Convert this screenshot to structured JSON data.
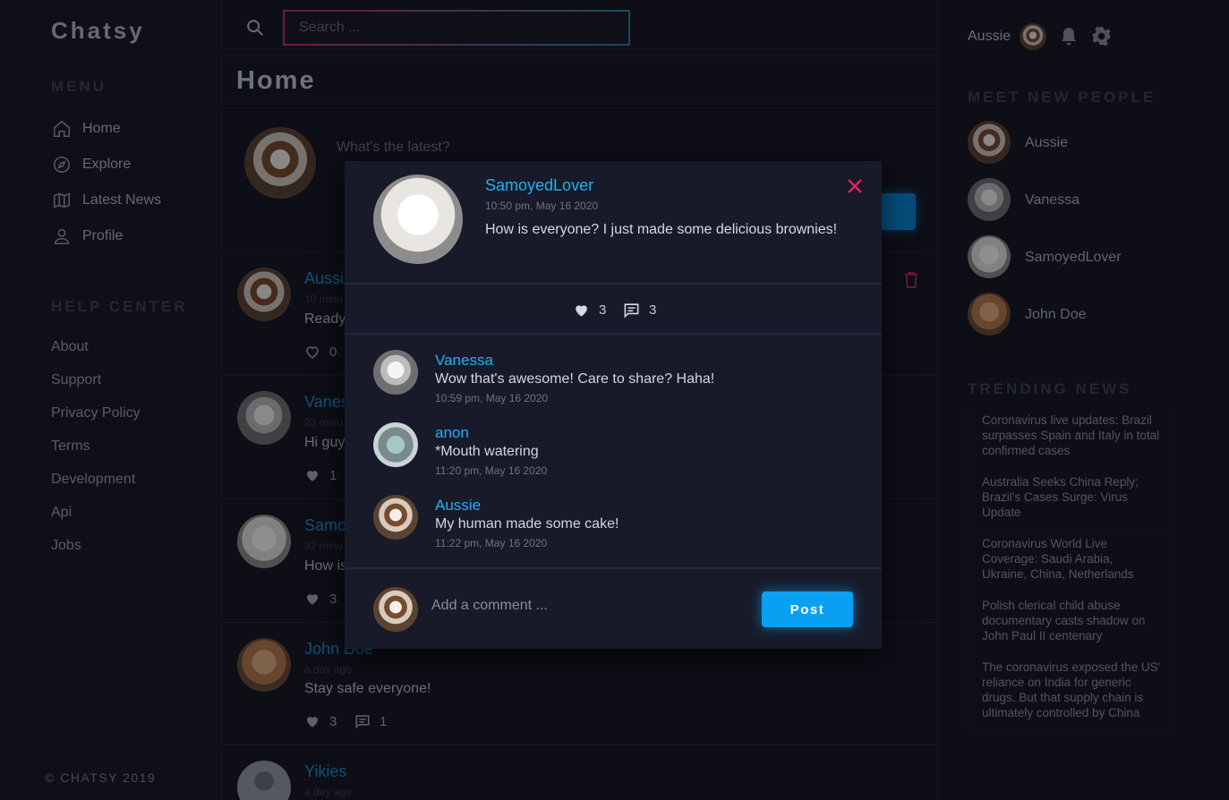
{
  "app": {
    "brand": "Chatsy",
    "copyright": "© CHATSY 2019"
  },
  "menu": {
    "heading": "MENU",
    "items": [
      {
        "label": "Home",
        "icon": "home-icon"
      },
      {
        "label": "Explore",
        "icon": "compass-icon"
      },
      {
        "label": "Latest News",
        "icon": "map-icon"
      },
      {
        "label": "Profile",
        "icon": "user-icon"
      }
    ]
  },
  "help": {
    "heading": "HELP CENTER",
    "items": [
      "About",
      "Support",
      "Privacy Policy",
      "Terms",
      "Development",
      "Api",
      "Jobs"
    ]
  },
  "search": {
    "placeholder": "Search ..."
  },
  "page": {
    "title": "Home"
  },
  "composer": {
    "placeholder": "What's the latest?"
  },
  "feed": [
    {
      "name": "Aussi",
      "time": "10 minu",
      "text": "Ready",
      "likes": "0"
    },
    {
      "name": "Vanes",
      "time": "23 minu",
      "text": "Hi guy",
      "likes": "1"
    },
    {
      "name": "Samo",
      "time": "32 minu",
      "text": "How is",
      "likes": "3"
    },
    {
      "name": "John Doe",
      "time": "a day ago",
      "text": "Stay safe everyone!",
      "likes": "3",
      "comments": "1"
    },
    {
      "name": "Yikies",
      "time": "a day ago"
    }
  ],
  "header": {
    "user_name": "Aussie"
  },
  "meet": {
    "heading": "MEET NEW PEOPLE",
    "people": [
      "Aussie",
      "Vanessa",
      "SamoyedLover",
      "John Doe"
    ]
  },
  "trending": {
    "heading": "TRENDING NEWS",
    "items": [
      "Coronavirus live updates: Brazil surpasses Spain and Italy in total confirmed cases",
      "Australia Seeks China Reply; Brazil's Cases Surge: Virus Update",
      "Coronavirus World Live Coverage: Saudi Arabia, Ukraine, China, Netherlands",
      "Polish clerical child abuse documentary casts shadow on John Paul II centenary",
      "The coronavirus exposed the US' reliance on India for generic drugs. But that supply chain is ultimately controlled by China"
    ]
  },
  "modal": {
    "author": "SamoyedLover",
    "time": "10:50 pm, May 16 2020",
    "text": "How is everyone? I just made some delicious brownies!",
    "likes": "3",
    "comments_count": "3",
    "comments": [
      {
        "name": "Vanessa",
        "text": "Wow that's awesome! Care to share? Haha!",
        "time": "10:59 pm, May 16 2020"
      },
      {
        "name": "anon",
        "text": "*Mouth watering",
        "time": "11:20 pm, May 16 2020"
      },
      {
        "name": "Aussie",
        "text": "My human made some cake!",
        "time": "11:22 pm, May 16 2020"
      }
    ],
    "comment_placeholder": "Add a comment ...",
    "post_label": "Post"
  },
  "colors": {
    "accent": "#21b1f2",
    "button": "#0aa0f2",
    "danger": "#e0245e",
    "background": "#14151f"
  }
}
